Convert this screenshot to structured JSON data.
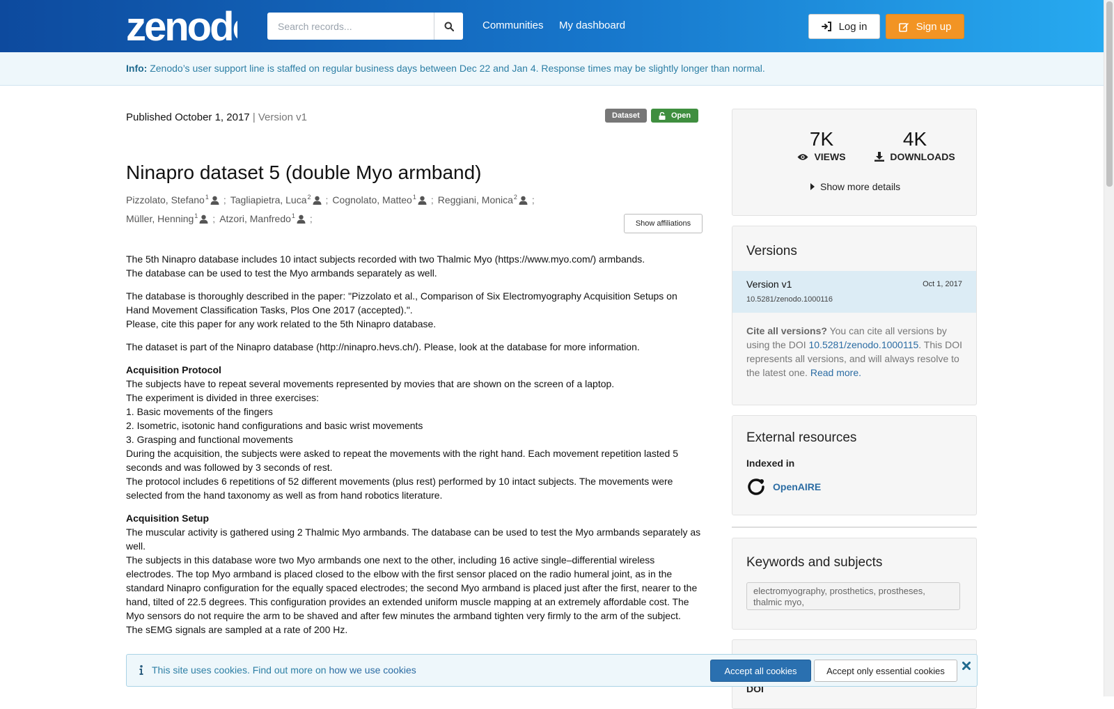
{
  "header": {
    "logo_text": "zenodo",
    "search_placeholder": "Search records...",
    "nav": [
      "Communities",
      "My dashboard"
    ],
    "login_label": "Log in",
    "signup_label": "Sign up",
    "brand_colors": {
      "gradient_start": "#0d4a9e",
      "gradient_end": "#27aaf0",
      "signup": "#f29424"
    }
  },
  "info_bar": {
    "label": "Info:",
    "text": "Zenodo’s user support line is staffed on regular business days between Dec 22 and Jan 4. Response times may be slightly longer than normal."
  },
  "record": {
    "published_prefix": "Published",
    "published_date": "October 1, 2017",
    "version_text": "| Version v1",
    "resource_type": "Dataset",
    "access": "Open",
    "title": "Ninapro dataset 5 (double Myo armband)",
    "creators": [
      {
        "name": "Pizzolato, Stefano",
        "affil": "1"
      },
      {
        "name": "Tagliapietra, Luca",
        "affil": "2"
      },
      {
        "name": "Cognolato, Matteo",
        "affil": "1"
      },
      {
        "name": "Reggiani, Monica",
        "affil": "2"
      },
      {
        "name": "Müller, Henning",
        "affil": "1"
      },
      {
        "name": "Atzori, Manfredo",
        "affil": "1"
      }
    ],
    "creator_separator": ";",
    "show_affiliations_label": "Show affiliations",
    "description": {
      "p1": [
        "The 5th Ninapro database includes 10 intact subjects recorded with two Thalmic Myo (https://www.myo.com/) armbands.",
        "The database can be used to test the Myo armbands separately as well."
      ],
      "p2": [
        "The database is thoroughly described in the paper: \"Pizzolato et al., Comparison of Six Electromyography Acquisition Setups on",
        "Hand Movement Classification Tasks, Plos One 2017 (accepted).\".",
        "Please, cite this paper for any work related to the 5th Ninapro database."
      ],
      "p3": "The dataset is part of the Ninapro database (http://ninapro.hevs.ch/). Please, look at the database for more information.",
      "h_protocol": "Acquisition Protocol",
      "protocol": [
        "The subjects have to repeat several movements represented by movies that are shown on the screen of a laptop.",
        "The experiment is divided in three exercises:",
        "1. Basic movements of the fingers",
        "2. Isometric, isotonic hand configurations and basic wrist movements",
        "3. Grasping and functional movements",
        "During the acquisition, the subjects were asked to repeat the movements with the right hand. Each movement repetition lasted 5",
        "seconds and was followed by 3 seconds of rest.",
        "The protocol includes 6 repetitions of 52 different movements (plus rest) performed by 10 intact subjects. The movements were",
        "selected from the hand taxonomy as well as from hand robotics literature."
      ],
      "h_setup": "Acquisition Setup",
      "setup": [
        "The muscular activity is gathered using 2 Thalmic Myo armbands. The database can be used to test the Myo armbands separately as",
        "well.",
        "The subjects in this database wore two Myo armbands one next to the other, including 16 active single–differential wireless",
        "electrodes. The top Myo armband is placed closed to the elbow with the first sensor placed on the radio humeral joint, as in the",
        "standard Ninapro configuration for the equally spaced electrodes; the second Myo armband is placed just after the first, nearer to the",
        "hand, tilted of 22.5 degrees. This configuration provides an extended uniform muscle mapping at an extremely affordable cost. The",
        "Myo sensors do not require the arm to be shaved and after few minutes the armband tighten very firmly to the arm of the subject.",
        "The sEMG signals are sampled at a rate of 200 Hz."
      ]
    }
  },
  "sidebar": {
    "stats": {
      "views_count": "7K",
      "views_label": "VIEWS",
      "downloads_count": "4K",
      "downloads_label": "DOWNLOADS",
      "more_details_label": "Show more details"
    },
    "versions": {
      "heading": "Versions",
      "current": {
        "label": "Version v1",
        "date": "Oct 1, 2017",
        "doi": "10.5281/zenodo.1000116"
      },
      "cite_all_bold": "Cite all versions?",
      "cite_all_text1": " You can cite all versions by using the DOI ",
      "concept_doi": "10.5281/zenodo.1000115",
      "cite_all_text2": ". This DOI represents all versions, and will always resolve to the latest one. ",
      "read_more": "Read more."
    },
    "external": {
      "heading": "External resources",
      "indexed_in": "Indexed in",
      "openaire": "OpenAIRE"
    },
    "keywords": {
      "heading": "Keywords and subjects",
      "value": "electromyography, prosthetics, prostheses, thalmic myo,"
    },
    "doi_label": "DOI"
  },
  "cookie_banner": {
    "text": "This site uses cookies. Find out more on ",
    "link": "how we use cookies",
    "accept_all": "Accept all cookies",
    "accept_essential": "Accept only essential cookies"
  }
}
